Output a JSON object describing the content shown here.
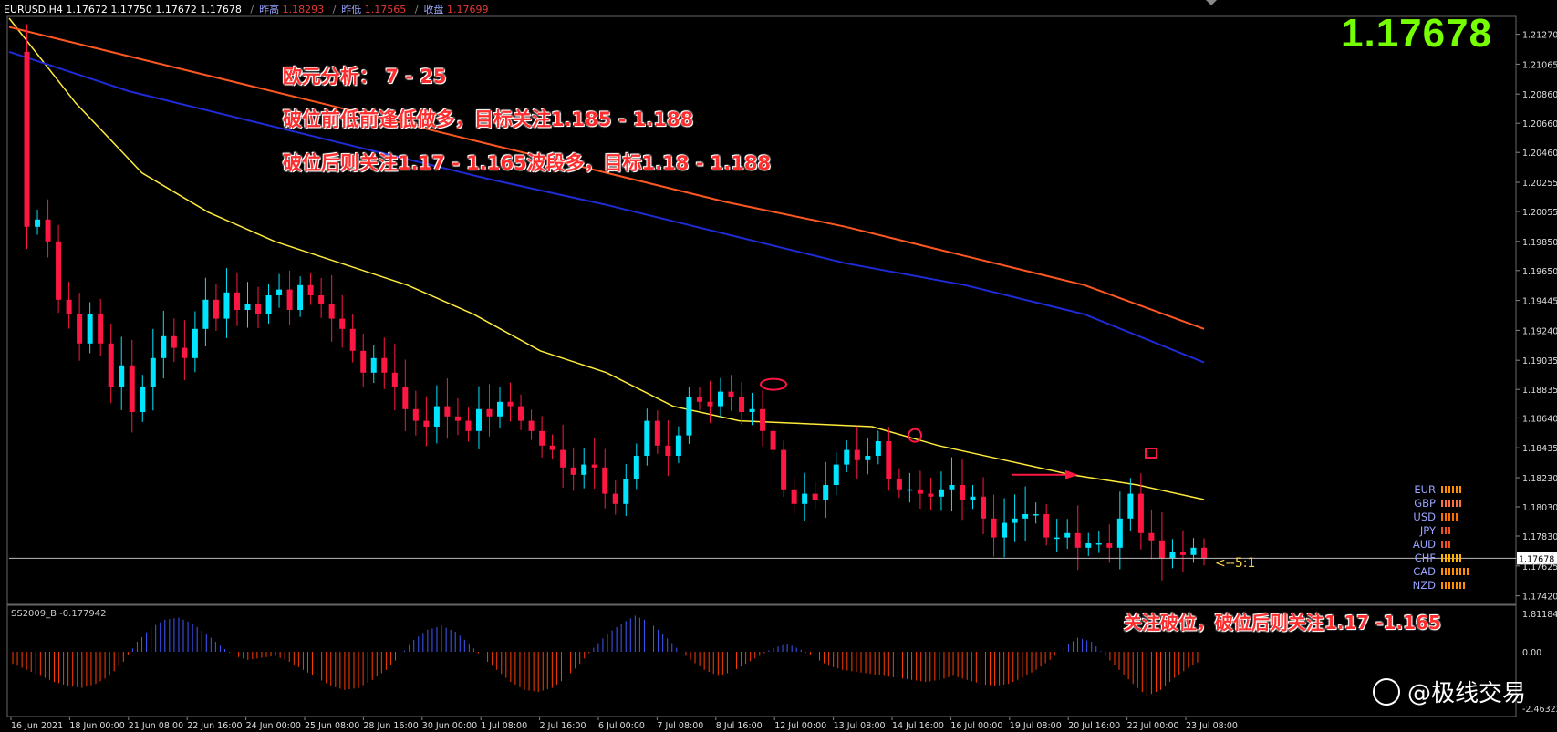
{
  "header": {
    "symbol_line": "EURUSD,H4  1.17672 1.17750 1.17672 1.17678",
    "prev_high_label": "昨高",
    "prev_high_value": "1.18293",
    "prev_low_label": "昨低",
    "prev_low_value": "1.17565",
    "close_label": "收盘",
    "close_value": "1.17699"
  },
  "current_price": "1.17678",
  "notes": {
    "line1": "欧元分析： 7 - 25",
    "line2": "破位前低前逢低做多，目标关注1.185 - 1.188",
    "line3": "破位后则关注1.17 - 1.165波段多，目标1.18 - 1.188",
    "bottom": "关注破位，破位后则关注1.17 -1.165"
  },
  "ratio_label": "<--5:1",
  "currency_strength": [
    {
      "name": "EUR",
      "bars": 6,
      "color": "#ff8f00"
    },
    {
      "name": "GBP",
      "bars": 6,
      "color": "#ff7043"
    },
    {
      "name": "USD",
      "bars": 5,
      "color": "#ff6f00"
    },
    {
      "name": "JPY",
      "bars": 3,
      "color": "#f4511e"
    },
    {
      "name": "AUD",
      "bars": 3,
      "color": "#f4511e"
    },
    {
      "name": "CHF",
      "bars": 6,
      "color": "#ffb300"
    },
    {
      "name": "CAD",
      "bars": 8,
      "color": "#ff8f00"
    },
    {
      "name": "NZD",
      "bars": 7,
      "color": "#ff8f00"
    }
  ],
  "oscillator": {
    "label": "SS2009_B -0.177942",
    "top_value": "1.811846",
    "zero_value": "0.00",
    "bottom_value": "-2.463227"
  },
  "watermark": "@极线交易",
  "chart_data": {
    "type": "candlestick",
    "symbol": "EURUSD",
    "timeframe": "H4",
    "ylim": [
      1.1738,
      1.2138
    ],
    "y_ticks": [
      "1.21270",
      "1.21065",
      "1.20860",
      "1.20660",
      "1.20460",
      "1.20255",
      "1.20055",
      "1.19850",
      "1.19650",
      "1.19445",
      "1.19240",
      "1.19035",
      "1.18835",
      "1.18640",
      "1.18435",
      "1.18230",
      "1.18030",
      "1.17830",
      "1.17625",
      "1.17420"
    ],
    "x_ticks": [
      "16 Jun 2021",
      "18 Jun 00:00",
      "21 Jun 08:00",
      "22 Jun 16:00",
      "24 Jun 00:00",
      "25 Jun 08:00",
      "28 Jun 16:00",
      "30 Jun 00:00",
      "1 Jul 08:00",
      "2 Jul 16:00",
      "6 Jul 00:00",
      "7 Jul 08:00",
      "8 Jul 16:00",
      "12 Jul 00:00",
      "13 Jul 08:00",
      "14 Jul 16:00",
      "16 Jul 00:00",
      "19 Jul 08:00",
      "20 Jul 16:00",
      "22 Jul 00:00",
      "23 Jul 08:00"
    ],
    "close_path": [
      1.2115,
      1.1995,
      1.2,
      1.1985,
      1.1945,
      1.1935,
      1.1915,
      1.1935,
      1.1915,
      1.1885,
      1.19,
      1.1868,
      1.1885,
      1.1905,
      1.192,
      1.1912,
      1.1905,
      1.1925,
      1.1945,
      1.1932,
      1.195,
      1.1938,
      1.1942,
      1.1935,
      1.1948,
      1.1952,
      1.1938,
      1.1955,
      1.1948,
      1.1942,
      1.1932,
      1.1925,
      1.191,
      1.1895,
      1.1905,
      1.1895,
      1.1885,
      1.187,
      1.1862,
      1.1858,
      1.1872,
      1.1865,
      1.1862,
      1.1855,
      1.187,
      1.1865,
      1.1875,
      1.1872,
      1.1862,
      1.1855,
      1.1845,
      1.1842,
      1.183,
      1.1825,
      1.1832,
      1.183,
      1.1812,
      1.1805,
      1.1822,
      1.1838,
      1.1862,
      1.1845,
      1.1838,
      1.1852,
      1.1878,
      1.1875,
      1.1872,
      1.1882,
      1.1878,
      1.1868,
      1.187,
      1.1855,
      1.1842,
      1.1815,
      1.1805,
      1.1812,
      1.1808,
      1.1818,
      1.1832,
      1.1842,
      1.1835,
      1.1838,
      1.1848,
      1.1822,
      1.1815,
      1.1815,
      1.1812,
      1.181,
      1.1815,
      1.1818,
      1.1808,
      1.181,
      1.1795,
      1.1782,
      1.1792,
      1.1795,
      1.1798,
      1.1798,
      1.1782,
      1.1782,
      1.1785,
      1.1775,
      1.1778,
      1.1778,
      1.1775,
      1.1795,
      1.1812,
      1.1785,
      1.178,
      1.1768,
      1.1772,
      1.177,
      1.1775,
      1.1768
    ],
    "moving_averages": [
      {
        "color": "#ffeb3b",
        "values": [
          1.2138,
          1.208,
          1.2032,
          1.2005,
          1.1985,
          1.197,
          1.1955,
          1.1935,
          1.191,
          1.1895,
          1.1872,
          1.1862,
          1.186,
          1.1858,
          1.1845,
          1.1835,
          1.1825,
          1.1818,
          1.1808
        ]
      },
      {
        "color": "#1e2bd6",
        "values": [
          1.2115,
          1.2088,
          1.2068,
          1.2048,
          1.2028,
          1.201,
          1.199,
          1.197,
          1.1955,
          1.1935,
          1.1902
        ]
      },
      {
        "color": "#ff5722",
        "values": [
          1.2132,
          1.2112,
          1.2092,
          1.2072,
          1.2052,
          1.2032,
          1.2012,
          1.1995,
          1.1975,
          1.1955,
          1.1925
        ]
      }
    ],
    "horizontal_line": 1.17678,
    "oscillator_values": [
      -0.6,
      -0.9,
      -1.2,
      -1.5,
      -1.7,
      -1.8,
      -1.6,
      -1.2,
      -0.5,
      0.5,
      1.2,
      1.6,
      1.7,
      1.4,
      0.9,
      0.3,
      -0.2,
      -0.4,
      -0.3,
      -0.2,
      -0.5,
      -0.9,
      -1.3,
      -1.7,
      -1.9,
      -1.8,
      -1.4,
      -0.9,
      -0.2,
      0.6,
      1.1,
      1.3,
      1.0,
      0.4,
      -0.3,
      -0.9,
      -1.5,
      -1.9,
      -2.0,
      -1.8,
      -1.3,
      -0.6,
      0.2,
      0.9,
      1.4,
      1.8,
      1.5,
      0.9,
      0.2,
      -0.4,
      -0.9,
      -1.2,
      -1.0,
      -0.6,
      -0.2,
      0.2,
      0.4,
      0.1,
      -0.3,
      -0.7,
      -0.9,
      -1.0,
      -1.1,
      -1.2,
      -1.3,
      -1.4,
      -1.5,
      -1.4,
      -1.2,
      -1.4,
      -1.6,
      -1.7,
      -1.6,
      -1.3,
      -0.9,
      -0.4,
      0.2,
      0.7,
      0.5,
      -0.2,
      -0.9,
      -1.6,
      -2.2,
      -1.9,
      -1.3,
      -0.8,
      -0.4
    ]
  }
}
